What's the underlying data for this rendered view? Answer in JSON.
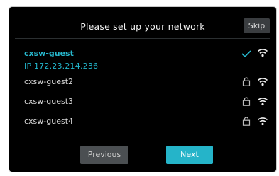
{
  "header": {
    "title": "Please set up your network",
    "skip_label": "Skip"
  },
  "networks": [
    {
      "name": "cxsw-guest",
      "ip": "IP  172.23.214.236",
      "status": "connected",
      "status_icon": "check-icon",
      "signal_icon": "wifi-icon"
    },
    {
      "name": "cxsw-guest2",
      "status": "locked",
      "status_icon": "lock-icon",
      "signal_icon": "wifi-icon"
    },
    {
      "name": "cxsw-guest3",
      "status": "locked",
      "status_icon": "lock-icon",
      "signal_icon": "wifi-icon"
    },
    {
      "name": "cxsw-guest4",
      "status": "locked",
      "status_icon": "lock-icon",
      "signal_icon": "wifi-icon"
    }
  ],
  "footer": {
    "previous_label": "Previous",
    "next_label": "Next"
  },
  "colors": {
    "background": "#000000",
    "accent": "#25b4c9",
    "text": "#d9d9d9",
    "button_secondary": "#4b4f52"
  }
}
